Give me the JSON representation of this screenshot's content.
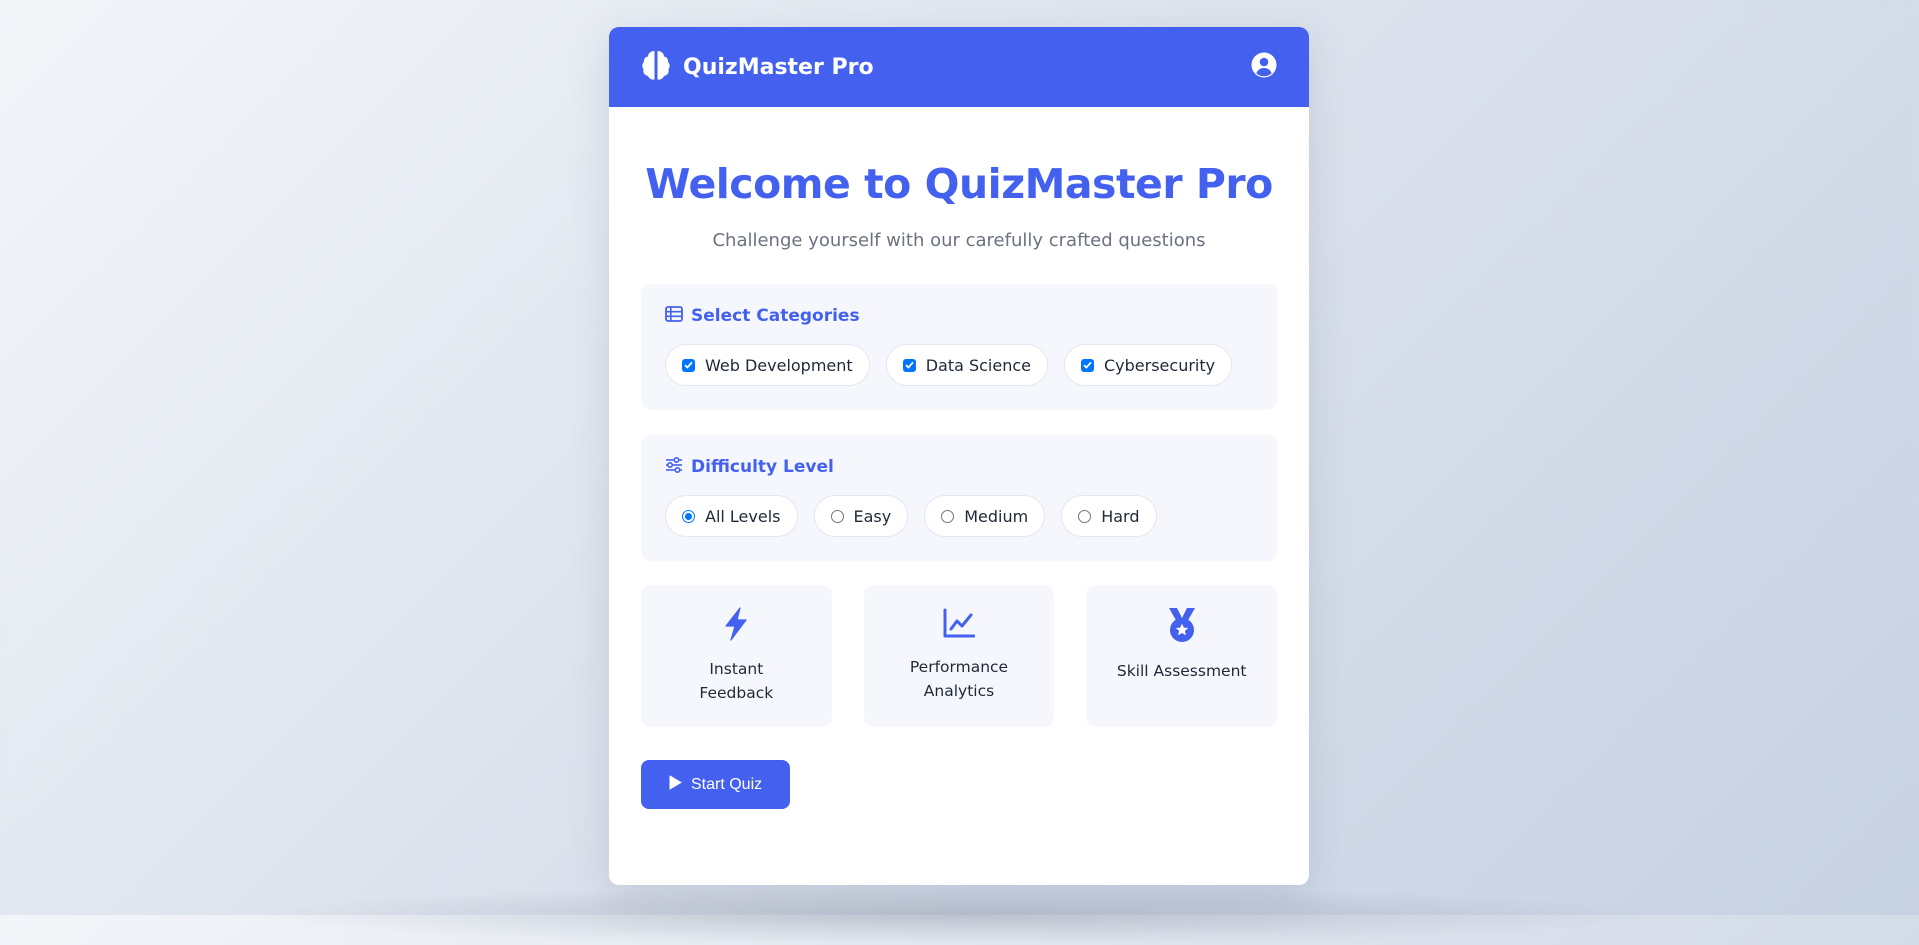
{
  "header": {
    "brand_icon": "brain-icon",
    "title": "QuizMaster Pro",
    "account_icon": "user-circle-icon"
  },
  "main": {
    "welcome_title": "Welcome to QuizMaster Pro",
    "subtitle": "Challenge yourself with our carefully crafted questions"
  },
  "categories": {
    "icon": "table-list-icon",
    "title": "Select Categories",
    "options": [
      {
        "label": "Web Development",
        "checked": true
      },
      {
        "label": "Data Science",
        "checked": true
      },
      {
        "label": "Cybersecurity",
        "checked": true
      }
    ]
  },
  "difficulty": {
    "icon": "sliders-icon",
    "title": "Difficulty Level",
    "selected": "All Levels",
    "options": [
      {
        "label": "All Levels",
        "selected": true
      },
      {
        "label": "Easy",
        "selected": false
      },
      {
        "label": "Medium",
        "selected": false
      },
      {
        "label": "Hard",
        "selected": false
      }
    ]
  },
  "features": [
    {
      "icon": "bolt-icon",
      "label": "Instant Feedback"
    },
    {
      "icon": "chart-line-icon",
      "label": "Performance Analytics"
    },
    {
      "icon": "medal-icon",
      "label": "Skill Assessment"
    }
  ],
  "start_button": {
    "icon": "play-icon",
    "label": "Start Quiz"
  },
  "colors": {
    "primary": "#4361ee",
    "panel_background": "#f5f7fc",
    "control_accent": "#0075ff"
  }
}
